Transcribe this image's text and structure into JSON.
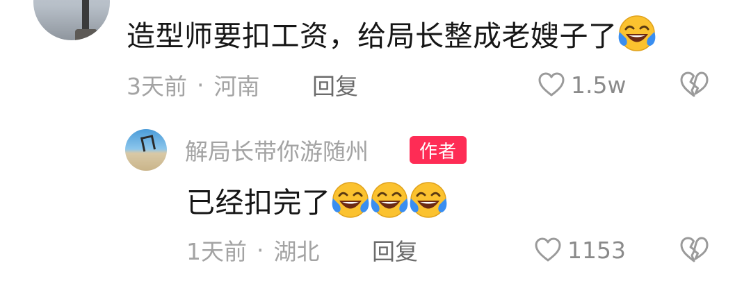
{
  "comment": {
    "text": "造型师要扣工资，给局长整成老嫂子了",
    "time": "3天前",
    "separator": "·",
    "location": "河南",
    "reply_label": "回复",
    "like_count": "1.5w",
    "emoji_count": 1,
    "icons": {
      "like": "heart-outline-icon",
      "dislike": "broken-heart-icon",
      "emoji": "laughing-crying-emoji-icon"
    }
  },
  "reply": {
    "username": "解局长带你游随州",
    "badge": "作者",
    "text": "已经扣完了",
    "time": "1天前",
    "separator": "·",
    "location": "湖北",
    "reply_label": "回复",
    "like_count": "1153",
    "emoji_count": 3,
    "icons": {
      "like": "heart-outline-icon",
      "dislike": "broken-heart-icon",
      "emoji": "laughing-crying-emoji-icon"
    }
  },
  "colors": {
    "text": "#161616",
    "meta": "#a3a3a3",
    "reply": "#6b6b6b",
    "badge_bg": "#fe2c55",
    "badge_text": "#ffffff",
    "emoji_face": "#fbc22f",
    "emoji_tear": "#3a8ef0"
  }
}
